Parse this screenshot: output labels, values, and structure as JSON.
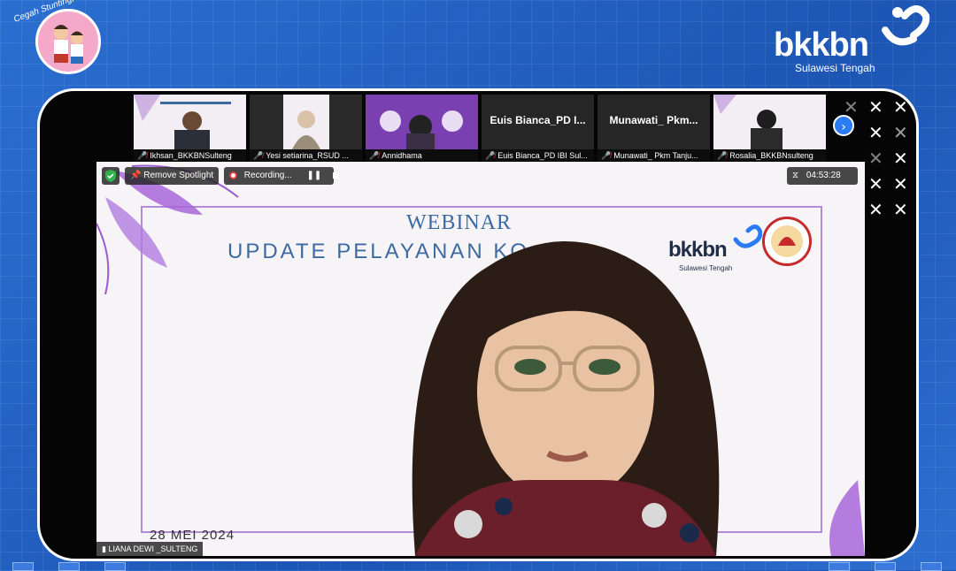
{
  "badge": {
    "text": "Cegah Stunting, Itu Penting!"
  },
  "brand": {
    "name": "bkkbn",
    "region": "Sulawesi Tengah"
  },
  "participants": [
    {
      "name": "Ikhsan_BKKBNSulteng",
      "video": true,
      "muted": true
    },
    {
      "name": "Yesi setiarina_RSUD ...",
      "video": true,
      "muted": true
    },
    {
      "name": "Annidhama",
      "video": true,
      "muted": true
    },
    {
      "name": "Euis Bianca_PD IBI Sul...",
      "label": "Euis  Bianca_PD  I...",
      "video": false,
      "muted": true
    },
    {
      "name": "Munawati_ Pkm Tanju...",
      "label": "Munawati_  Pkm...",
      "video": false,
      "muted": true
    },
    {
      "name": "Rosalia_BKKBNsulteng",
      "video": true,
      "muted": true
    }
  ],
  "controls": {
    "remove_spotlight": "Remove Spotlight",
    "recording": "Recording...",
    "pause_icon": "pause-icon",
    "stop_icon": "stop-icon",
    "timer": "04:53:28"
  },
  "slide": {
    "title1": "WEBINAR",
    "title2": "UPDATE PELAYANAN KO",
    "date": "28 MEI 2024",
    "logo_name": "bkkbn",
    "logo_region": "Sulawesi Tengah"
  },
  "speaker": {
    "name": "LIANA DEWI _SULTENG"
  },
  "colors": {
    "background": "#1f5fbf",
    "accent_purple": "#b58ad6",
    "mute_red": "#e23b3b",
    "zoom_blue": "#2a7cf6"
  }
}
